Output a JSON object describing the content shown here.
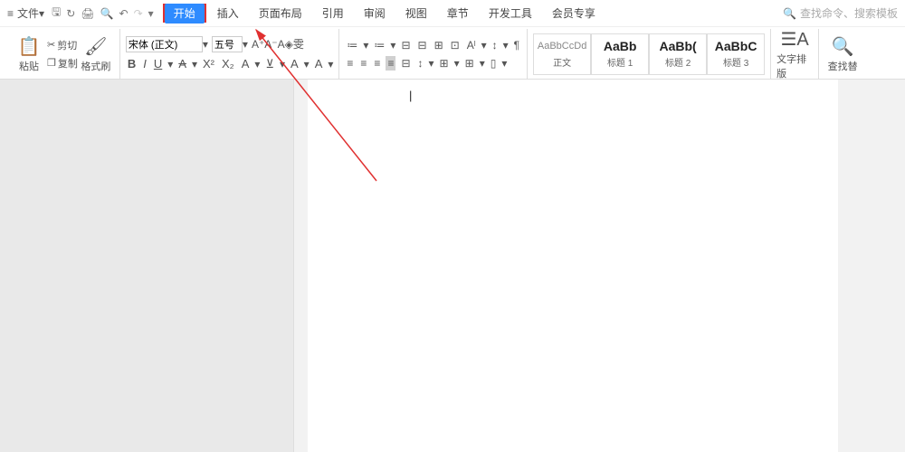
{
  "menu": {
    "file": "文件",
    "qat_icons": [
      "save-icon",
      "refresh-icon",
      "print-icon",
      "preview-icon",
      "undo-icon",
      "redo-icon",
      "dropdown-icon"
    ],
    "qat_glyphs": [
      "🖫",
      "↻",
      "🖨",
      "🔍",
      "↶",
      "↷",
      "▾"
    ],
    "tabs": [
      "开始",
      "插入",
      "页面布局",
      "引用",
      "审阅",
      "视图",
      "章节",
      "开发工具",
      "会员专享"
    ],
    "active_tab_index": 0,
    "search_placeholder": "查找命令、搜索模板"
  },
  "ribbon": {
    "paste": "粘贴",
    "cut": "剪切",
    "copy": "复制",
    "format_painter": "格式刷",
    "font_name": "宋体 (正文)",
    "font_size": "五号",
    "font_buttons_top": [
      "A⁺",
      "A⁻",
      "A",
      "◈",
      "雯"
    ],
    "font_buttons": [
      "B",
      "I",
      "U",
      "A",
      "X²",
      "X₂",
      "A",
      "⊻",
      "A",
      "A"
    ],
    "para_buttons_top": [
      "≔",
      "≔",
      "⊟",
      "⊟",
      "⊞",
      "⊡",
      "Aˡ",
      "↕",
      "¶"
    ],
    "para_buttons_bot": [
      "≡",
      "≡",
      "≡",
      "≡",
      "⊟",
      "↕",
      "⊞",
      "⊞",
      "▯"
    ],
    "styles": [
      {
        "preview": "AaBbCcDd",
        "name": "正文",
        "light": true
      },
      {
        "preview": "AaBb",
        "name": "标题 1",
        "light": false
      },
      {
        "preview": "AaBb(",
        "name": "标题 2",
        "light": false
      },
      {
        "preview": "AaBbC",
        "name": "标题 3",
        "light": false
      }
    ],
    "text_arrange": "文字排版",
    "find_replace": "查找替"
  },
  "annotation": {
    "arrow_color": "#e03030"
  }
}
